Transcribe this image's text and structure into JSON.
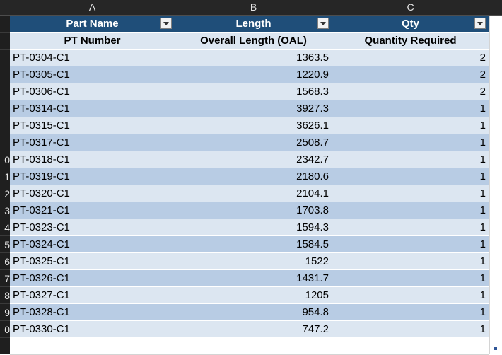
{
  "columns": [
    "A",
    "B",
    "C"
  ],
  "header": {
    "a": "Part Name",
    "b": "Length",
    "c": "Qty"
  },
  "subheader": {
    "a": "PT Number",
    "b": "Overall Length (OAL)",
    "c": "Quantity Required"
  },
  "row_labels": [
    "",
    "",
    "",
    "",
    "",
    "",
    "",
    "",
    "0",
    "1",
    "2",
    "3",
    "4",
    "5",
    "6",
    "7",
    "8",
    "9",
    "0"
  ],
  "rows": [
    {
      "pt": "PT-0304-C1",
      "oal": "1363.5",
      "qty": "2"
    },
    {
      "pt": "PT-0305-C1",
      "oal": "1220.9",
      "qty": "2"
    },
    {
      "pt": "PT-0306-C1",
      "oal": "1568.3",
      "qty": "2"
    },
    {
      "pt": "PT-0314-C1",
      "oal": "3927.3",
      "qty": "1"
    },
    {
      "pt": "PT-0315-C1",
      "oal": "3626.1",
      "qty": "1"
    },
    {
      "pt": "PT-0317-C1",
      "oal": "2508.7",
      "qty": "1"
    },
    {
      "pt": "PT-0318-C1",
      "oal": "2342.7",
      "qty": "1"
    },
    {
      "pt": "PT-0319-C1",
      "oal": "2180.6",
      "qty": "1"
    },
    {
      "pt": "PT-0320-C1",
      "oal": "2104.1",
      "qty": "1"
    },
    {
      "pt": "PT-0321-C1",
      "oal": "1703.8",
      "qty": "1"
    },
    {
      "pt": "PT-0323-C1",
      "oal": "1594.3",
      "qty": "1"
    },
    {
      "pt": "PT-0324-C1",
      "oal": "1584.5",
      "qty": "1"
    },
    {
      "pt": "PT-0325-C1",
      "oal": "1522",
      "qty": "1"
    },
    {
      "pt": "PT-0326-C1",
      "oal": "1431.7",
      "qty": "1"
    },
    {
      "pt": "PT-0327-C1",
      "oal": "1205",
      "qty": "1"
    },
    {
      "pt": "PT-0328-C1",
      "oal": "954.8",
      "qty": "1"
    },
    {
      "pt": "PT-0330-C1",
      "oal": "747.2",
      "qty": "1"
    }
  ],
  "colors": {
    "header": "#1f4e79",
    "band_light": "#dce6f1",
    "band_dark": "#b8cce4"
  }
}
